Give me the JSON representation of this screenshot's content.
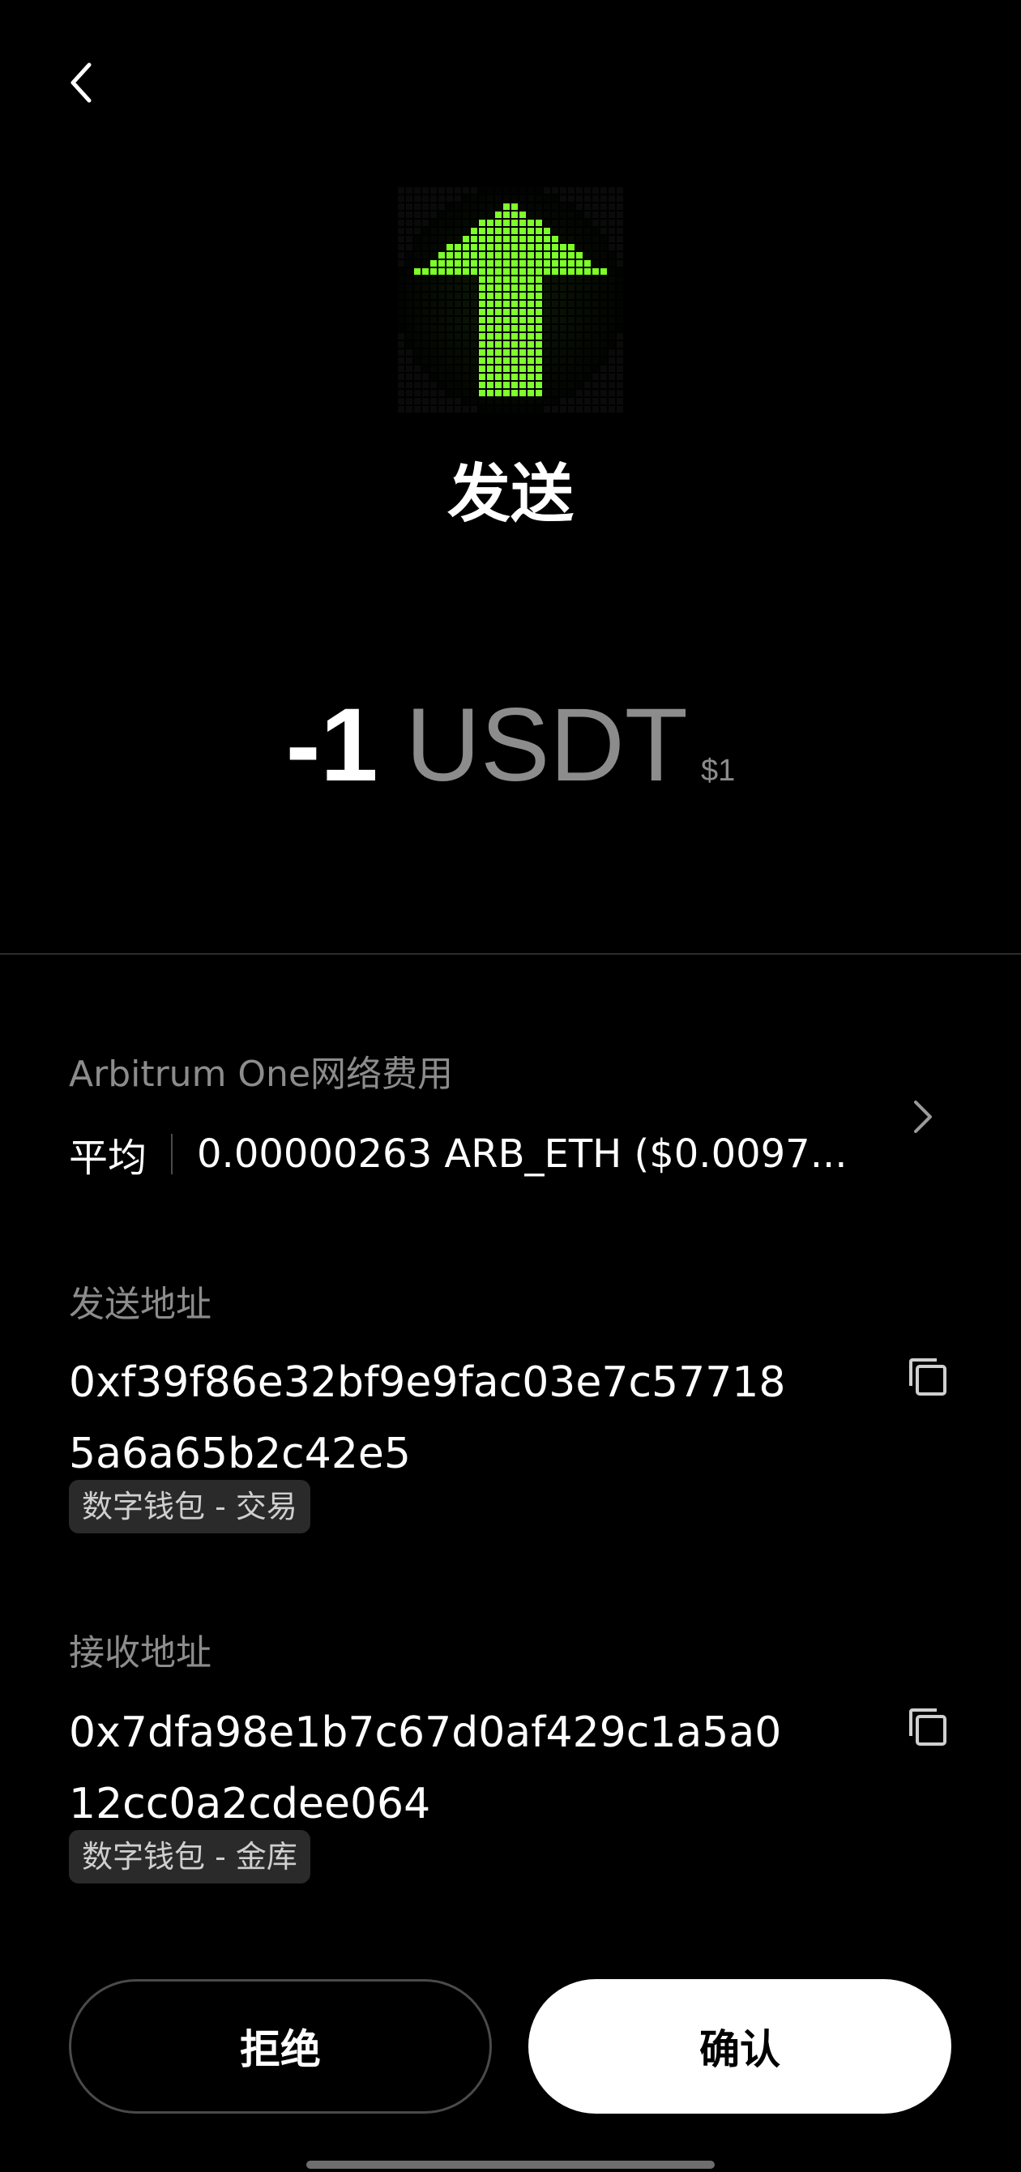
{
  "header": {
    "title": "发送",
    "back_icon": "chevron-left-icon",
    "hero_icon": "pixel-arrow-up-icon",
    "accent_color": "#7dff2a"
  },
  "amount": {
    "value": "-1",
    "unit": "USDT",
    "usd": "$1"
  },
  "fee": {
    "label": "Arbitrum One网络费用",
    "speed": "平均",
    "amount": "0.00000263 ARB_ETH ($0.0097...",
    "chevron_icon": "chevron-right-icon"
  },
  "from": {
    "label": "发送地址",
    "address_line1": "0xf39f86e32bf9e9fac03e7c57718",
    "address_line2": "5a6a65b2c42e5",
    "tag": "数字钱包 - 交易",
    "copy_icon": "copy-icon"
  },
  "to": {
    "label": "接收地址",
    "address_line1": "0x7dfa98e1b7c67d0af429c1a5a0",
    "address_line2": "12cc0a2cdee064",
    "tag": "数字钱包 - 金库",
    "copy_icon": "copy-icon"
  },
  "actions": {
    "reject_label": "拒绝",
    "confirm_label": "确认"
  }
}
